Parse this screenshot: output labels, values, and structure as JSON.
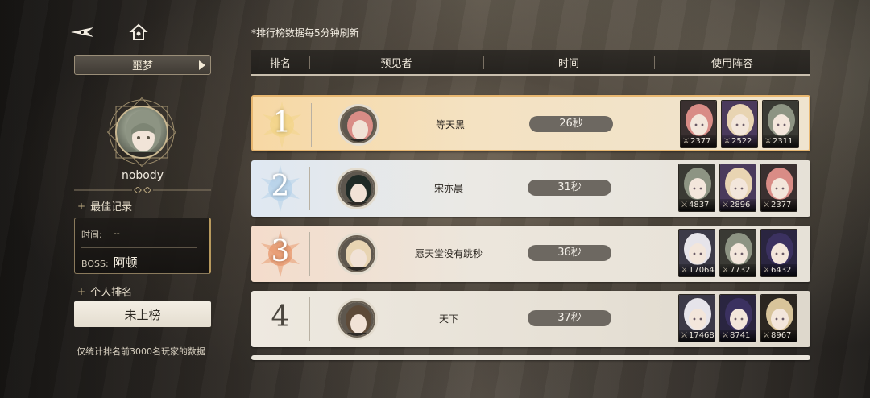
{
  "refresh_note": "*排行榜数据每5分钟刷新",
  "mode": {
    "label": "噩梦"
  },
  "player": {
    "name": "nobody"
  },
  "best": {
    "title": "最佳记录",
    "time_label": "时间:",
    "time_value": "--",
    "boss_label": "BOSS:",
    "boss_value": "阿顿"
  },
  "personal": {
    "title": "个人排名",
    "value": "未上榜"
  },
  "note": "仅统计排名前3000名玩家的数据",
  "headers": {
    "rank": "排名",
    "player": "预见者",
    "time": "时间",
    "team": "使用阵容"
  },
  "rows": [
    {
      "rank": "1",
      "name": "等天黑",
      "time": "26秒",
      "team": [
        {
          "power": "2377",
          "hair": "#d98c86",
          "bg": "#3a3030"
        },
        {
          "power": "2522",
          "hair": "#e8d4b2",
          "bg": "#4a3a5c"
        },
        {
          "power": "2311",
          "hair": "#8d9483",
          "bg": "#3a3a34"
        }
      ]
    },
    {
      "rank": "2",
      "name": "宋亦晨",
      "time": "31秒",
      "team": [
        {
          "power": "4837",
          "hair": "#8d9483",
          "bg": "#3a3a34"
        },
        {
          "power": "2896",
          "hair": "#e8d4b2",
          "bg": "#4a3a5c"
        },
        {
          "power": "2377",
          "hair": "#d98c86",
          "bg": "#3a3030"
        }
      ]
    },
    {
      "rank": "3",
      "name": "愿天堂没有跳秒",
      "time": "36秒",
      "team": [
        {
          "power": "17064",
          "hair": "#e6e4ea",
          "bg": "#3c3a48"
        },
        {
          "power": "7732",
          "hair": "#8d9483",
          "bg": "#3a3a34"
        },
        {
          "power": "6432",
          "hair": "#3b3160",
          "bg": "#2a2540"
        }
      ]
    },
    {
      "rank": "4",
      "name": "天下",
      "time": "37秒",
      "team": [
        {
          "power": "17468",
          "hair": "#e6e4ea",
          "bg": "#3c3a48"
        },
        {
          "power": "8741",
          "hair": "#3b3160",
          "bg": "#2a2540"
        },
        {
          "power": "8967",
          "hair": "#d8c49a",
          "bg": "#2b2620"
        }
      ]
    }
  ]
}
